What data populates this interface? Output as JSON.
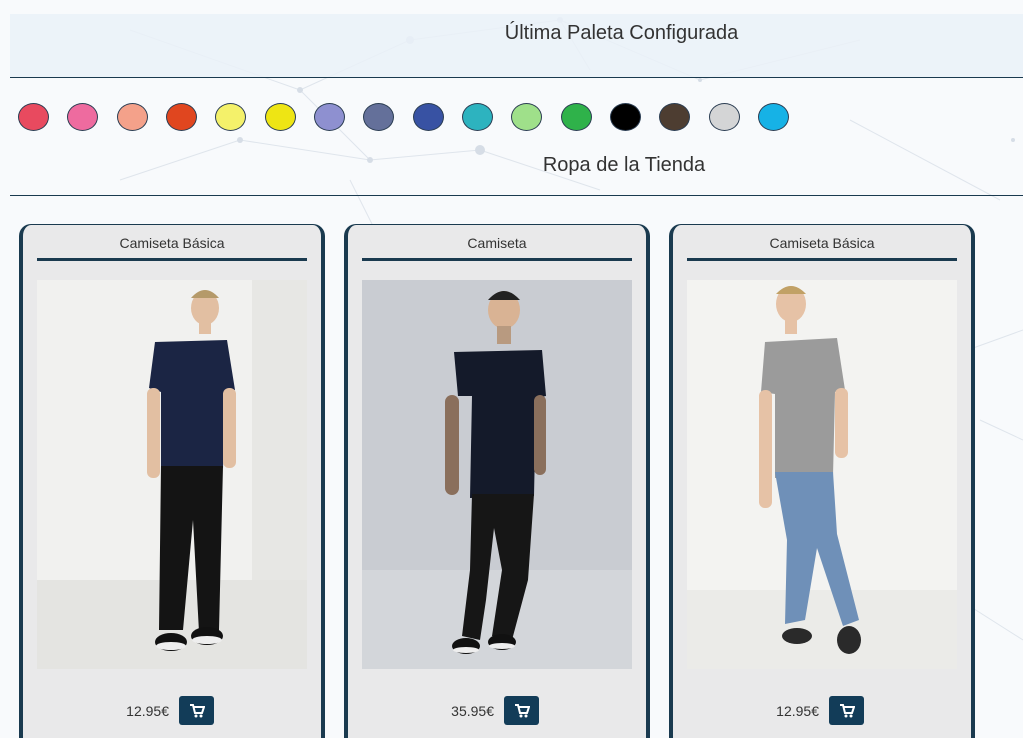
{
  "palette": {
    "title": "Última Paleta Configurada",
    "colors": [
      "#e84a5f",
      "#ee6b9f",
      "#f4a18a",
      "#e0461f",
      "#f4f16a",
      "#eee514",
      "#8e90d0",
      "#64709a",
      "#3852a3",
      "#2db3bf",
      "#9fe08a",
      "#2fb24a",
      "#000000",
      "#4d3d31",
      "#d4d5d6",
      "#16b2e6"
    ]
  },
  "store": {
    "title": "Ropa de la Tienda",
    "products": [
      {
        "name": "Camiseta Básica",
        "price": "12.95€",
        "shirt_color": "#1b2544",
        "pants_color": "#141414"
      },
      {
        "name": "Camiseta",
        "price": "35.95€",
        "shirt_color": "#141a2a",
        "pants_color": "#161616"
      },
      {
        "name": "Camiseta Básica",
        "price": "12.95€",
        "shirt_color": "#9b9b9b",
        "pants_color": "#6f90b8"
      }
    ]
  },
  "accent": "#123c58"
}
